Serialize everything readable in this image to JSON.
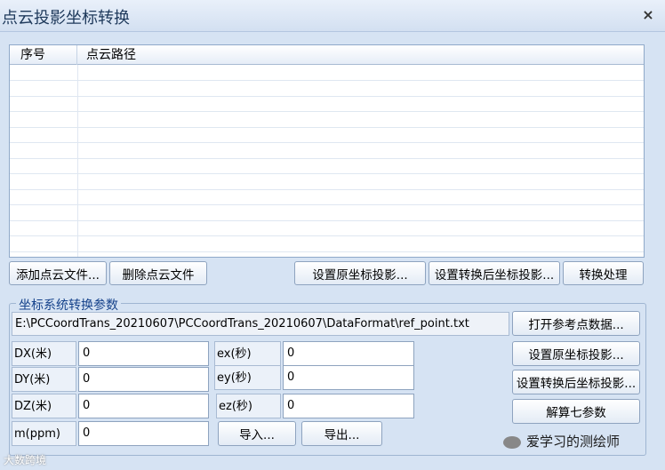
{
  "window": {
    "title": "点云投影坐标转换",
    "close": "×"
  },
  "list": {
    "columns": [
      "序号",
      "点云路径"
    ]
  },
  "buttons": {
    "add_file": "添加点云文件...",
    "delete_file": "删除点云文件",
    "set_src_proj": "设置原坐标投影...",
    "set_dst_proj": "设置转换后坐标投影...",
    "convert": "转换处理"
  },
  "params": {
    "legend": "坐标系统转换参数",
    "path": "E:\\PCCoordTrans_20210607\\PCCoordTrans_20210607\\DataFormat\\ref_point.txt",
    "open_ref": "打开参考点数据...",
    "set_src_proj": "设置原坐标投影...",
    "set_dst_proj": "设置转换后坐标投影...",
    "solve": "解算七参数",
    "import": "导入...",
    "export": "导出...",
    "dx_label": "DX(米)",
    "dx_value": "0",
    "dy_label": "DY(米)",
    "dy_value": "0",
    "dz_label": "DZ(米)",
    "dz_value": "0",
    "m_label": "m(ppm)",
    "m_value": "0",
    "ex_label": "ex(秒)",
    "ex_value": "0",
    "ey_label": "ey(秒)",
    "ey_value": "0",
    "ez_label": "ez(秒)",
    "ez_value": "0"
  },
  "watermark": {
    "left": "大数跨境",
    "right": "爱学习的测绘师"
  }
}
